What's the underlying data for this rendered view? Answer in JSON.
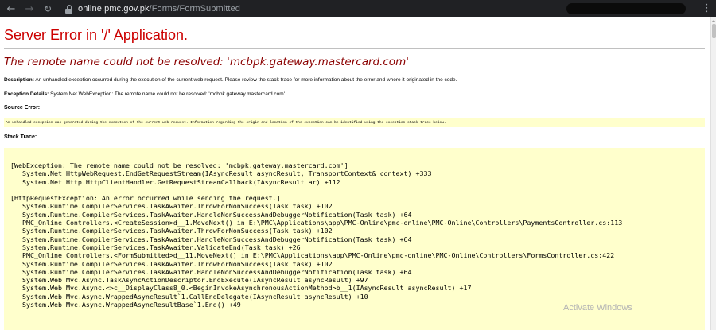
{
  "browser": {
    "back_icon": "←",
    "forward_icon": "→",
    "reload_icon": "↻",
    "url_host": "online.pmc.gov.pk",
    "url_path": "/Forms/FormSubmitted",
    "more_icon": "⋮"
  },
  "page": {
    "title": "Server Error in '/' Application.",
    "error_message": "The remote name could not be resolved: 'mcbpk.gateway.mastercard.com'",
    "description_label": "Description:",
    "description_text": "An unhandled exception occurred during the execution of the current web request. Please review the stack trace for more information about the error and where it originated in the code.",
    "exception_label": "Exception Details:",
    "exception_text": "System.Net.WebException: The remote name could not be resolved: 'mcbpk.gateway.mastercard.com'",
    "source_error_label": "Source Error:",
    "source_error_text": "An unhandled exception was generated during the execution of the current web request. Information regarding the origin and location of the exception can be identified using the exception stack trace below.",
    "stack_trace_label": "Stack Trace:",
    "stack_trace": {
      "l00": "[WebException: The remote name could not be resolved: 'mcbpk.gateway.mastercard.com']",
      "l01": "System.Net.HttpWebRequest.EndGetRequestStream(IAsyncResult asyncResult, TransportContext& context) +333",
      "l02": "System.Net.Http.HttpClientHandler.GetRequestStreamCallback(IAsyncResult ar) +112",
      "l03": "[HttpRequestException: An error occurred while sending the request.]",
      "l04": "System.Runtime.CompilerServices.TaskAwaiter.ThrowForNonSuccess(Task task) +102",
      "l05": "System.Runtime.CompilerServices.TaskAwaiter.HandleNonSuccessAndDebuggerNotification(Task task) +64",
      "l06": "PMC_Online.Controllers.<CreateSession>d__1.MoveNext() in E:\\PMC\\Applications\\app\\PMC-Online\\pmc-online\\PMC-Online\\Controllers\\PaymentsController.cs:113",
      "l07": "System.Runtime.CompilerServices.TaskAwaiter.ThrowForNonSuccess(Task task) +102",
      "l08": "System.Runtime.CompilerServices.TaskAwaiter.HandleNonSuccessAndDebuggerNotification(Task task) +64",
      "l09": "System.Runtime.CompilerServices.TaskAwaiter.ValidateEnd(Task task) +26",
      "l10": "PMC_Online.Controllers.<FormSubmitted>d__11.MoveNext() in E:\\PMC\\Applications\\app\\PMC-Online\\pmc-online\\PMC-Online\\Controllers\\FormsController.cs:422",
      "l11": "System.Runtime.CompilerServices.TaskAwaiter.ThrowForNonSuccess(Task task) +102",
      "l12": "System.Runtime.CompilerServices.TaskAwaiter.HandleNonSuccessAndDebuggerNotification(Task task) +64",
      "l13": "System.Web.Mvc.Async.TaskAsyncActionDescriptor.EndExecute(IAsyncResult asyncResult) +97",
      "l14": "System.Web.Mvc.Async.<>c__DisplayClass8_0.<BeginInvokeAsynchronousActionMethod>b__1(IAsyncResult asyncResult) +17",
      "l15": "System.Web.Mvc.Async.WrappedAsyncResult`1.CallEndDelegate(IAsyncResult asyncResult) +10",
      "l16": "System.Web.Mvc.Async.WrappedAsyncResultBase`1.End() +49"
    }
  },
  "watermark": "Activate Windows"
}
